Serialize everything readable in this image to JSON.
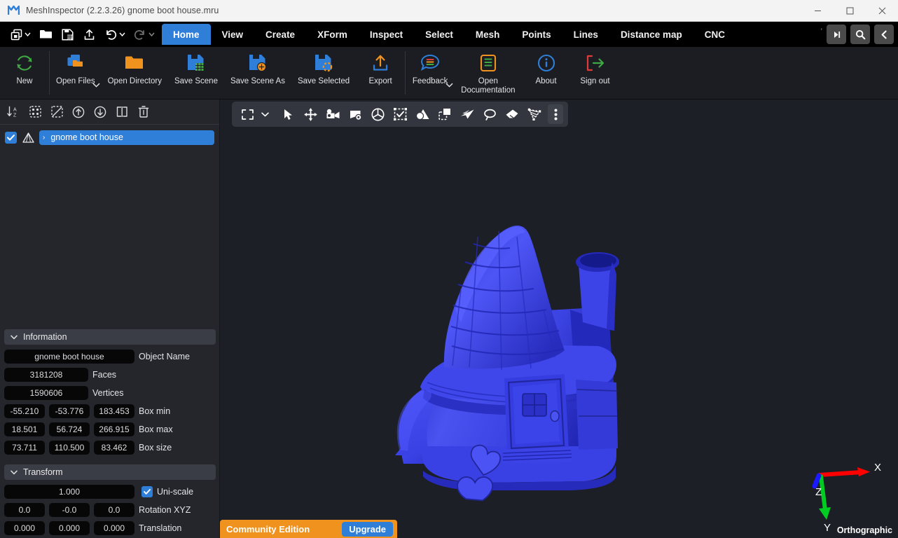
{
  "titlebar": {
    "app_title": "MeshInspector (2.2.3.26) gnome boot house.mru",
    "logo_icon": "meshinspector-logo-icon",
    "minimize_label": "—",
    "maximize_label": "□",
    "close_label": "✕"
  },
  "quick_access": [
    {
      "name": "new-scene",
      "icon": "new-window-icon",
      "caret": true
    },
    {
      "name": "open-file",
      "icon": "folder-open-icon",
      "caret": false
    },
    {
      "name": "save-scene",
      "icon": "floppy-save-icon",
      "caret": false
    },
    {
      "name": "export",
      "icon": "upload-export-icon",
      "caret": false
    },
    {
      "name": "undo",
      "icon": "undo-arrow-icon",
      "caret": true
    },
    {
      "name": "redo",
      "icon": "redo-arrow-icon",
      "caret": true
    }
  ],
  "tabs": [
    {
      "label": "Home",
      "active": true
    },
    {
      "label": "View",
      "active": false
    },
    {
      "label": "Create",
      "active": false
    },
    {
      "label": "XForm",
      "active": false
    },
    {
      "label": "Inspect",
      "active": false
    },
    {
      "label": "Select",
      "active": false
    },
    {
      "label": "Mesh",
      "active": false
    },
    {
      "label": "Points",
      "active": false
    },
    {
      "label": "Lines",
      "active": false
    },
    {
      "label": "Distance map",
      "active": false
    },
    {
      "label": "CNC",
      "active": false
    }
  ],
  "tabs_overflow_hint": "’",
  "tab_scroll_right_icon": "scroll-tabs-right-icon",
  "search_icon": "search-icon",
  "collapse_ribbon_icon": "chevron-left-icon",
  "ribbon": {
    "groups": [
      {
        "buttons": [
          {
            "label": "New",
            "icon": "refresh-circle-icon",
            "color": "#3fa843",
            "caret": false
          }
        ]
      },
      {
        "buttons": [
          {
            "label": "Open Files",
            "icon": "open-files-icon",
            "color": "#2f7fd9",
            "caret": true
          },
          {
            "label": "Open Directory",
            "icon": "folder-icon",
            "color": "#f0921e",
            "caret": false
          },
          {
            "label": "Save Scene",
            "icon": "save-scene-icon",
            "color": "#2f7fd9",
            "caret": false
          },
          {
            "label": "Save Scene As",
            "icon": "save-scene-as-icon",
            "color": "#2f7fd9",
            "caret": false
          },
          {
            "label": "Save Selected",
            "icon": "save-selected-icon",
            "color": "#2f7fd9",
            "caret": false
          },
          {
            "label": "Export",
            "icon": "export-up-icon",
            "color": "#f0921e",
            "caret": false
          }
        ]
      },
      {
        "buttons": [
          {
            "label": "Feedback",
            "icon": "feedback-bubble-icon",
            "color": "#2f7fd9",
            "caret": true
          },
          {
            "label": "Open\nDocumentation",
            "icon": "documentation-icon",
            "color": "#f0921e",
            "caret": false
          },
          {
            "label": "About",
            "icon": "info-circle-icon",
            "color": "#2f7fd9",
            "caret": false
          },
          {
            "label": "Sign out",
            "icon": "sign-out-icon",
            "color": "#3fa843",
            "caret": false
          }
        ]
      }
    ]
  },
  "scene_tools": [
    {
      "name": "sort-az",
      "icon": "sort-alpha-icon"
    },
    {
      "name": "select-all",
      "icon": "select-all-icon"
    },
    {
      "name": "deselect-all",
      "icon": "deselect-icon"
    },
    {
      "name": "move-up",
      "icon": "arrow-up-circle-icon"
    },
    {
      "name": "move-down",
      "icon": "arrow-down-circle-icon"
    },
    {
      "name": "clone",
      "icon": "clone-icon"
    },
    {
      "name": "delete",
      "icon": "trash-icon"
    }
  ],
  "tree": {
    "items": [
      {
        "label": "gnome boot house",
        "checked": true,
        "selected": true,
        "type_icon": "mesh-triangle-icon",
        "expander": "›"
      }
    ]
  },
  "information": {
    "title": "Information",
    "collapsed": false,
    "object_name": {
      "value": "gnome boot house",
      "label": "Object Name"
    },
    "faces": {
      "value": "3181208",
      "label": "Faces"
    },
    "vertices": {
      "value": "1590606",
      "label": "Vertices"
    },
    "box_min": {
      "values": [
        "-55.210",
        "-53.776",
        "183.453"
      ],
      "label": "Box min"
    },
    "box_max": {
      "values": [
        "18.501",
        "56.724",
        "266.915"
      ],
      "label": "Box max"
    },
    "box_size": {
      "values": [
        "73.711",
        "110.500",
        "83.462"
      ],
      "label": "Box size"
    }
  },
  "transform": {
    "title": "Transform",
    "collapsed": false,
    "scale": {
      "value": "1.000"
    },
    "uni_scale": {
      "label": "Uni-scale",
      "checked": true
    },
    "rotation": {
      "values": [
        "0.0",
        "-0.0",
        "0.0"
      ],
      "label": "Rotation XYZ"
    },
    "translation": {
      "values": [
        "0.000",
        "0.000",
        "0.000"
      ],
      "label": "Translation"
    }
  },
  "viewport_toolbar": [
    {
      "name": "fit-to-screen",
      "icon": "fit-screen-icon"
    },
    {
      "name": "fit-dropdown",
      "icon": "chevron-down-icon"
    },
    {
      "name": "select-tool",
      "icon": "cursor-arrow-icon"
    },
    {
      "name": "move-tool",
      "icon": "move-cross-icon"
    },
    {
      "name": "camera-tool",
      "icon": "camera-icon"
    },
    {
      "name": "scene-settings",
      "icon": "scene-gear-icon"
    },
    {
      "name": "rotate-view",
      "icon": "rotate-sphere-icon"
    },
    {
      "name": "marquee-select",
      "icon": "marquee-check-icon"
    },
    {
      "name": "object-shading",
      "icon": "object-shading-icon"
    },
    {
      "name": "clipping-plane",
      "icon": "clipping-plane-icon"
    },
    {
      "name": "ribbon-tool",
      "icon": "paper-plane-icon"
    },
    {
      "name": "lasso-select",
      "icon": "lasso-icon"
    },
    {
      "name": "eraser",
      "icon": "eraser-icon"
    },
    {
      "name": "polygon-select",
      "icon": "polygon-select-icon"
    },
    {
      "name": "more-tools",
      "icon": "kebab-menu-icon"
    }
  ],
  "viewport": {
    "background": "#1d1f26",
    "model_name": "gnome boot house",
    "model_color": "#3b43e0",
    "projection_label": "Orthographic",
    "axes": [
      {
        "label": "X",
        "color": "#ff0000"
      },
      {
        "label": "Y",
        "color": "#00cc22"
      },
      {
        "label": "Z",
        "color": "#1a1aff"
      }
    ]
  },
  "banner": {
    "edition_label": "Community Edition",
    "upgrade_label": "Upgrade"
  }
}
